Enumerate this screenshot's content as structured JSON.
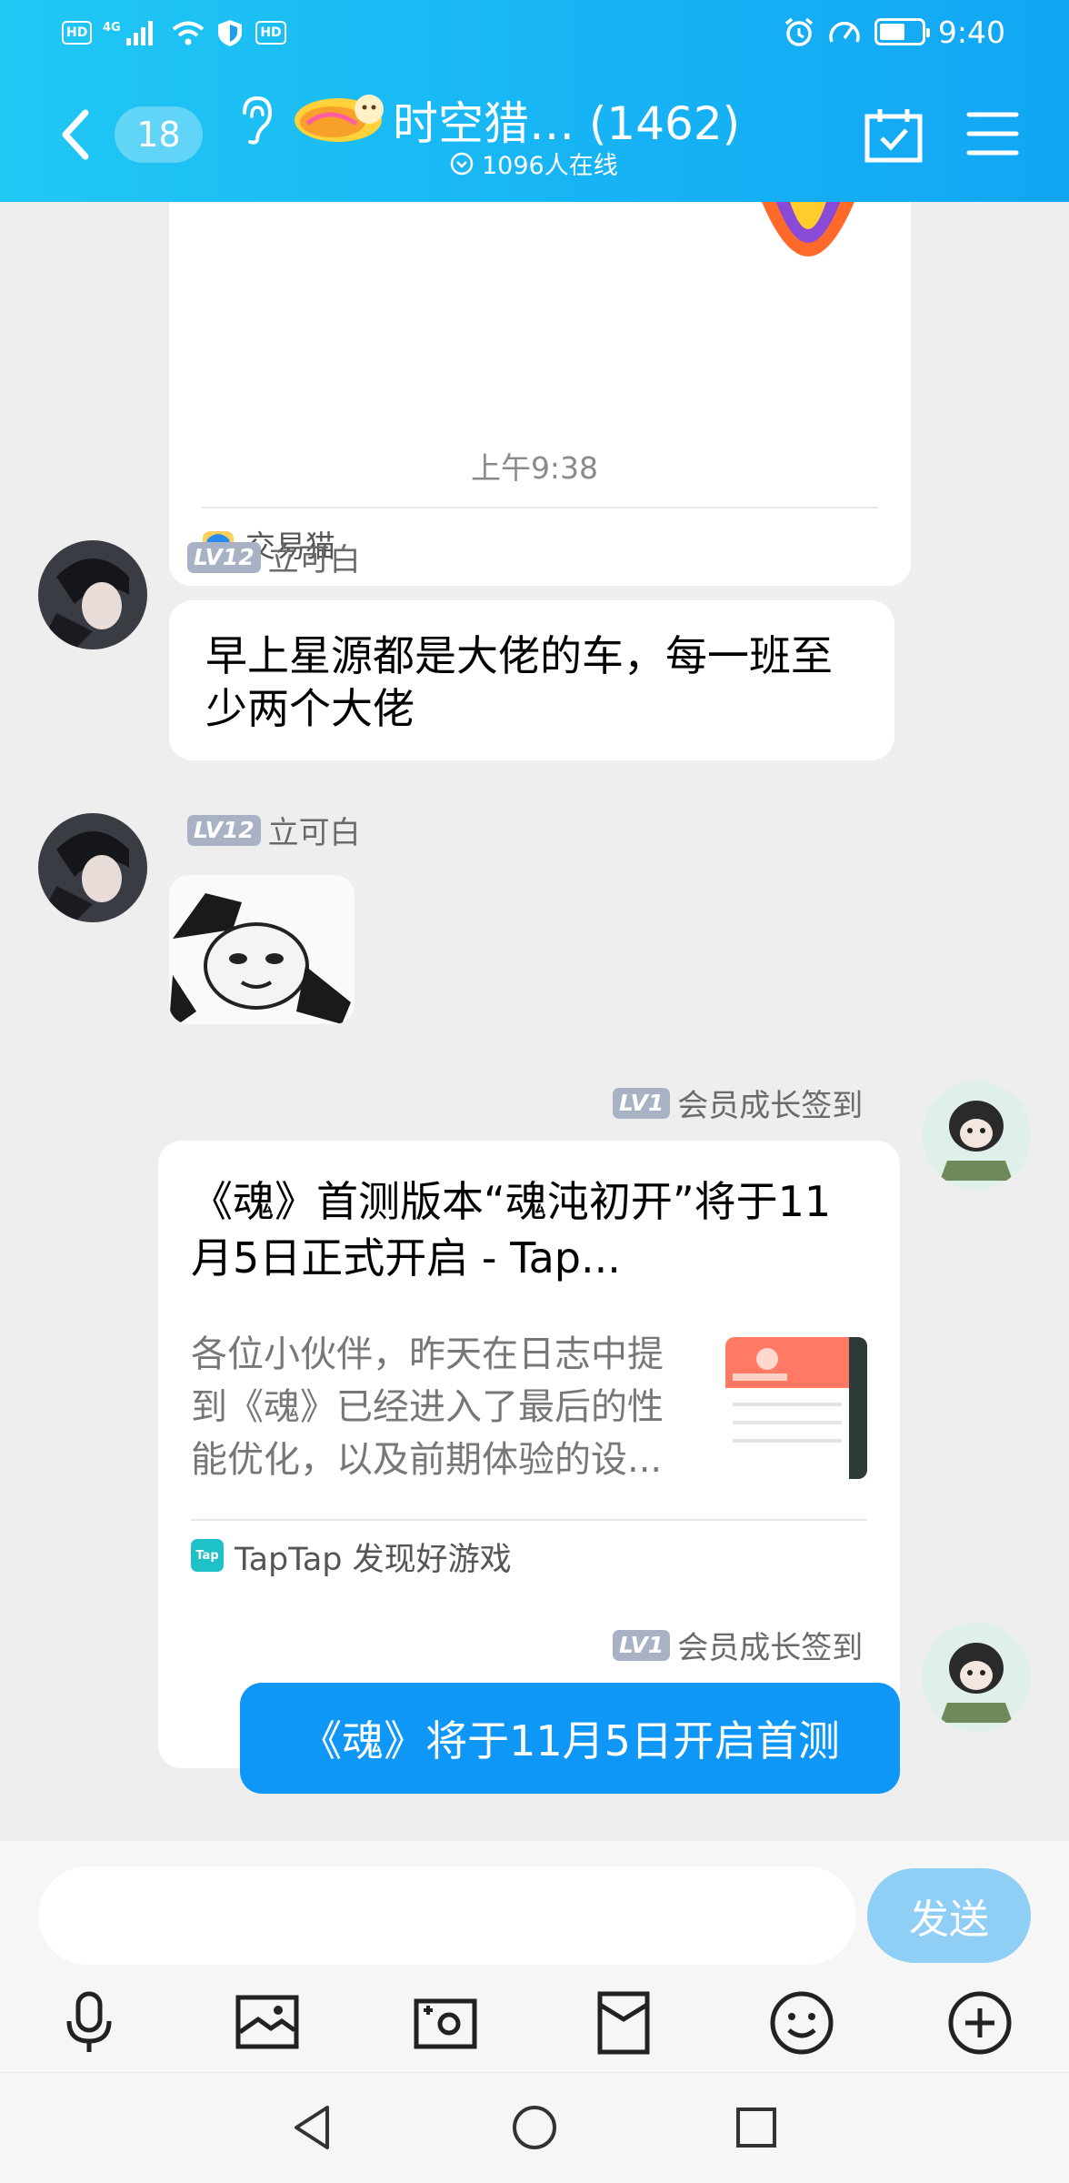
{
  "status_bar": {
    "left_badges": [
      "HD",
      "4G",
      "HD"
    ],
    "time": "9:40"
  },
  "header": {
    "unread_count": "18",
    "group_title": "时空猎… (1462)",
    "online_count": "1096人在线"
  },
  "chat": {
    "top_card": {
      "source": "交易猫"
    },
    "time_divider": "上午9:38",
    "messages": [
      {
        "level": "LV12",
        "sender": "立可白",
        "text": "早上星源都是大佬的车，每一班至少两个大佬"
      },
      {
        "level": "LV12",
        "sender": "立可白",
        "type": "sticker"
      },
      {
        "level": "LV1",
        "sender": "会员成长签到",
        "link_title": "《魂》首测版本“魂沌初开”将于11月5日正式开启 - Tap...",
        "link_desc": "各位小伙伴，昨天在日志中提到《魂》已经进入了最后的性能优化，以及前期体验的设...",
        "source_icon_text": "Tap",
        "source": "TapTap 发现好游戏"
      },
      {
        "level": "LV1",
        "sender": "会员成长签到",
        "text": "《魂》将于11月5日开启首测"
      }
    ]
  },
  "input": {
    "placeholder": "",
    "send_label": "发送"
  },
  "toolbar_icons": [
    "mic-icon",
    "image-icon",
    "camera-icon",
    "red-packet-icon",
    "emoji-icon",
    "plus-icon"
  ],
  "colors": {
    "header_start": "#20c8f4",
    "header_end": "#12a6f4",
    "bubble_self": "#0f97f8",
    "send_disabled": "#8fcff5"
  }
}
